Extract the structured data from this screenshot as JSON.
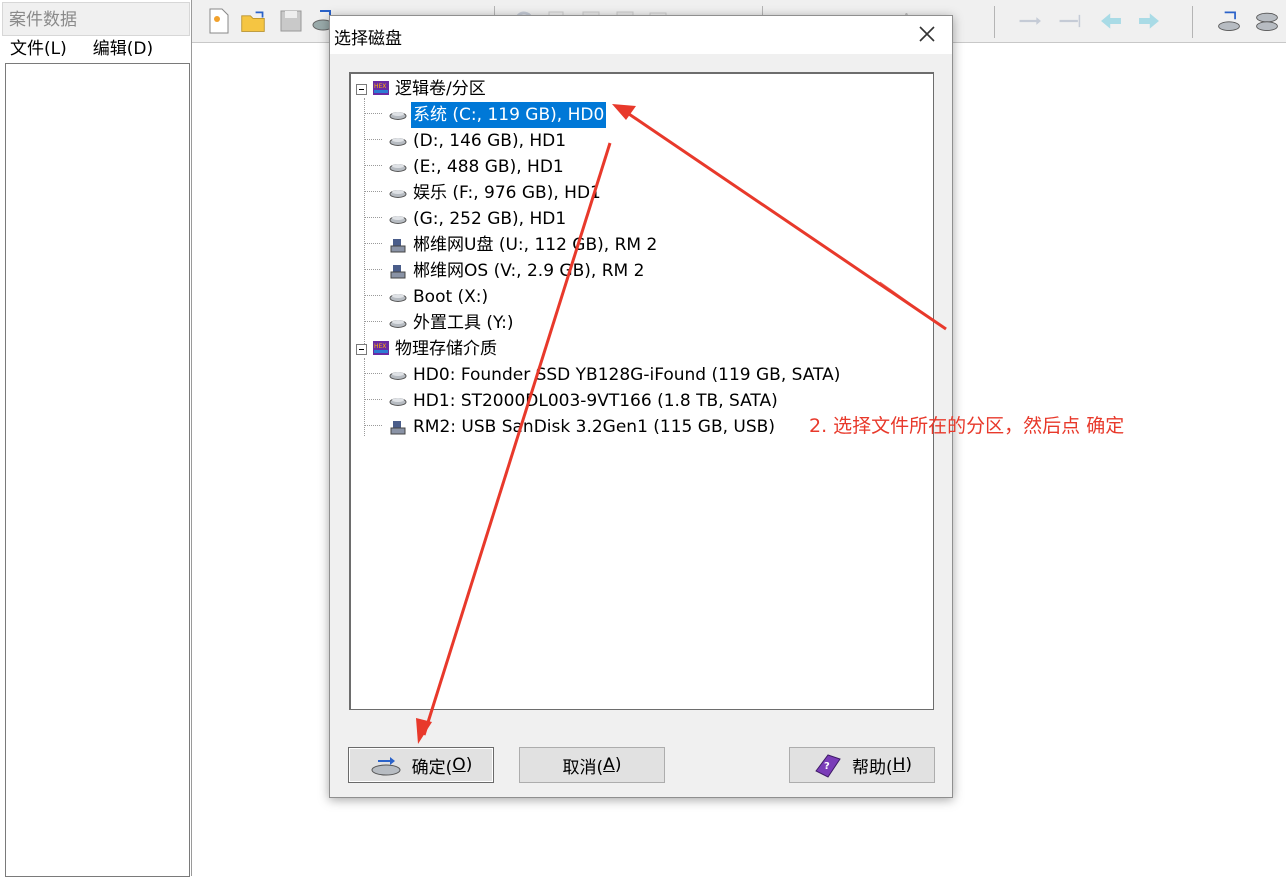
{
  "case_panel": {
    "title": "案件数据",
    "menu": [
      "文件(L)",
      "编辑(D)"
    ]
  },
  "dialog": {
    "title": "选择磁盘",
    "close_icon": "close-icon",
    "tree": {
      "logical_group": "逻辑卷/分区",
      "logical_items": [
        {
          "label": "系统 (C:, 119 GB), HD0",
          "icon": "hard-drive-icon",
          "selected": true
        },
        {
          "label": " (D:, 146 GB), HD1",
          "icon": "hard-drive-icon"
        },
        {
          "label": " (E:, 488 GB), HD1",
          "icon": "hard-drive-icon"
        },
        {
          "label": "娱乐 (F:, 976 GB), HD1",
          "icon": "hard-drive-icon"
        },
        {
          "label": " (G:, 252 GB), HD1",
          "icon": "hard-drive-icon"
        },
        {
          "label": "郴维网U盘 (U:, 112 GB), RM 2",
          "icon": "usb-drive-icon"
        },
        {
          "label": "郴维网OS (V:, 2.9 GB), RM 2",
          "icon": "usb-drive-icon"
        },
        {
          "label": "Boot (X:)",
          "icon": "hard-drive-icon"
        },
        {
          "label": "外置工具 (Y:)",
          "icon": "hard-drive-icon"
        }
      ],
      "physical_group": "物理存储介质",
      "physical_items": [
        {
          "label": "HD0: Founder SSD YB128G-iFound (119 GB, SATA)",
          "icon": "hard-drive-icon"
        },
        {
          "label": "HD1: ST2000DL003-9VT166 (1.8 TB, SATA)",
          "icon": "hard-drive-icon"
        },
        {
          "label": "RM2: USB SanDisk 3.2Gen1 (115 GB, USB)",
          "icon": "usb-drive-icon"
        }
      ]
    },
    "buttons": {
      "ok": {
        "text": "确定(",
        "key": "O",
        "end": ")"
      },
      "cancel": {
        "text": "取消(",
        "key": "A",
        "end": ")"
      },
      "help": {
        "text": "帮助(",
        "key": "H",
        "end": ")"
      }
    }
  },
  "annotation": {
    "text": "2. 选择文件所在的分区，然后点 确定",
    "color": "#e8392b"
  },
  "colors": {
    "selection": "#0078d7",
    "annotation_arrow": "#e8392b"
  }
}
